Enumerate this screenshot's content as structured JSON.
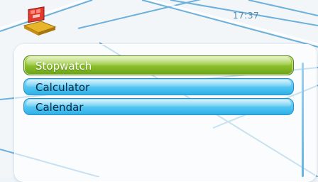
{
  "status": {
    "time": "17:37"
  },
  "header": {
    "icon": "toolbox-icon"
  },
  "menu": {
    "items": [
      {
        "label": "Stopwatch",
        "selected": true
      },
      {
        "label": "Calculator",
        "selected": false
      },
      {
        "label": "Calendar",
        "selected": false
      }
    ]
  },
  "colors": {
    "selected_item": "#8fc12d",
    "normal_item": "#55c6f2",
    "clock_text": "#5a86ad"
  }
}
